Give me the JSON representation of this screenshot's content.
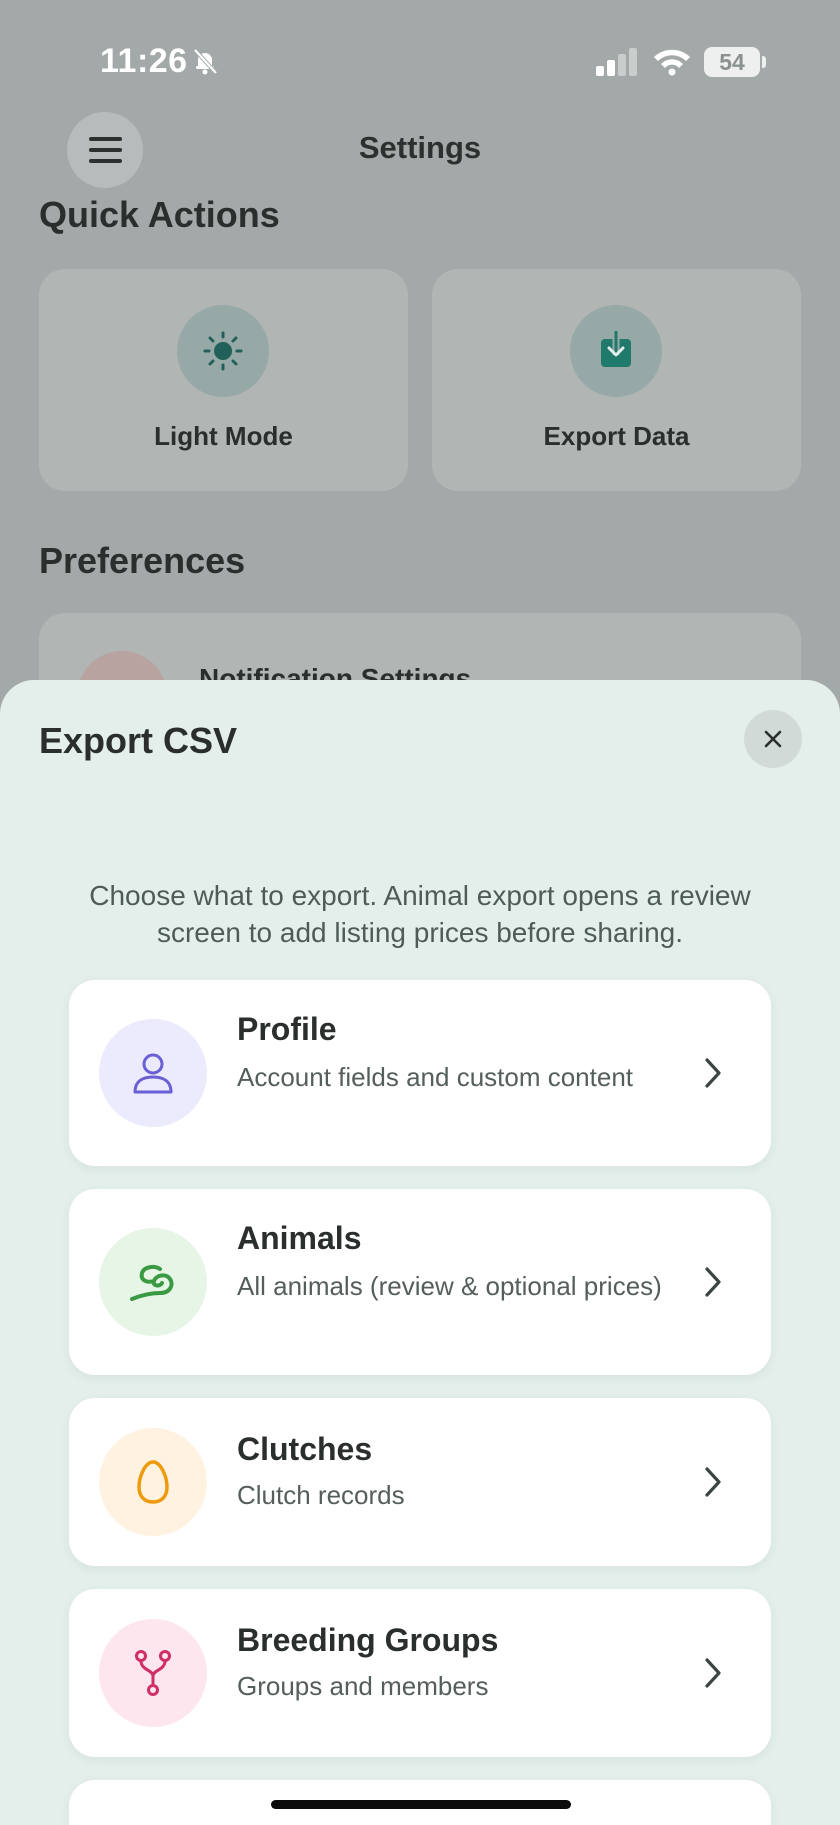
{
  "status_bar": {
    "time": "11:26",
    "battery": "54"
  },
  "header": {
    "title": "Settings"
  },
  "quick_actions": {
    "title": "Quick Actions",
    "items": [
      {
        "label": "Light Mode",
        "icon": "sun-icon"
      },
      {
        "label": "Export Data",
        "icon": "download-icon"
      }
    ]
  },
  "preferences": {
    "title": "Preferences",
    "items": [
      {
        "label": "Notification Settings"
      }
    ]
  },
  "sheet": {
    "title": "Export CSV",
    "subtitle": "Choose what to export. Animal export opens a review screen to add listing prices before sharing.",
    "options": [
      {
        "title": "Profile",
        "description": "Account fields and custom content",
        "icon": "person-icon",
        "accent": "#6a5fd4",
        "icon_bg": "#eceafd"
      },
      {
        "title": "Animals",
        "description": "All animals (review & optional prices)",
        "icon": "snake-icon",
        "accent": "#3a9a44",
        "icon_bg": "#e7f5e6"
      },
      {
        "title": "Clutches",
        "description": "Clutch records",
        "icon": "egg-icon",
        "accent": "#ef9a0c",
        "icon_bg": "#fff2e1"
      },
      {
        "title": "Breeding Groups",
        "description": "Groups and members",
        "icon": "branch-icon",
        "accent": "#cf2f66",
        "icon_bg": "#fde6ee"
      }
    ]
  }
}
